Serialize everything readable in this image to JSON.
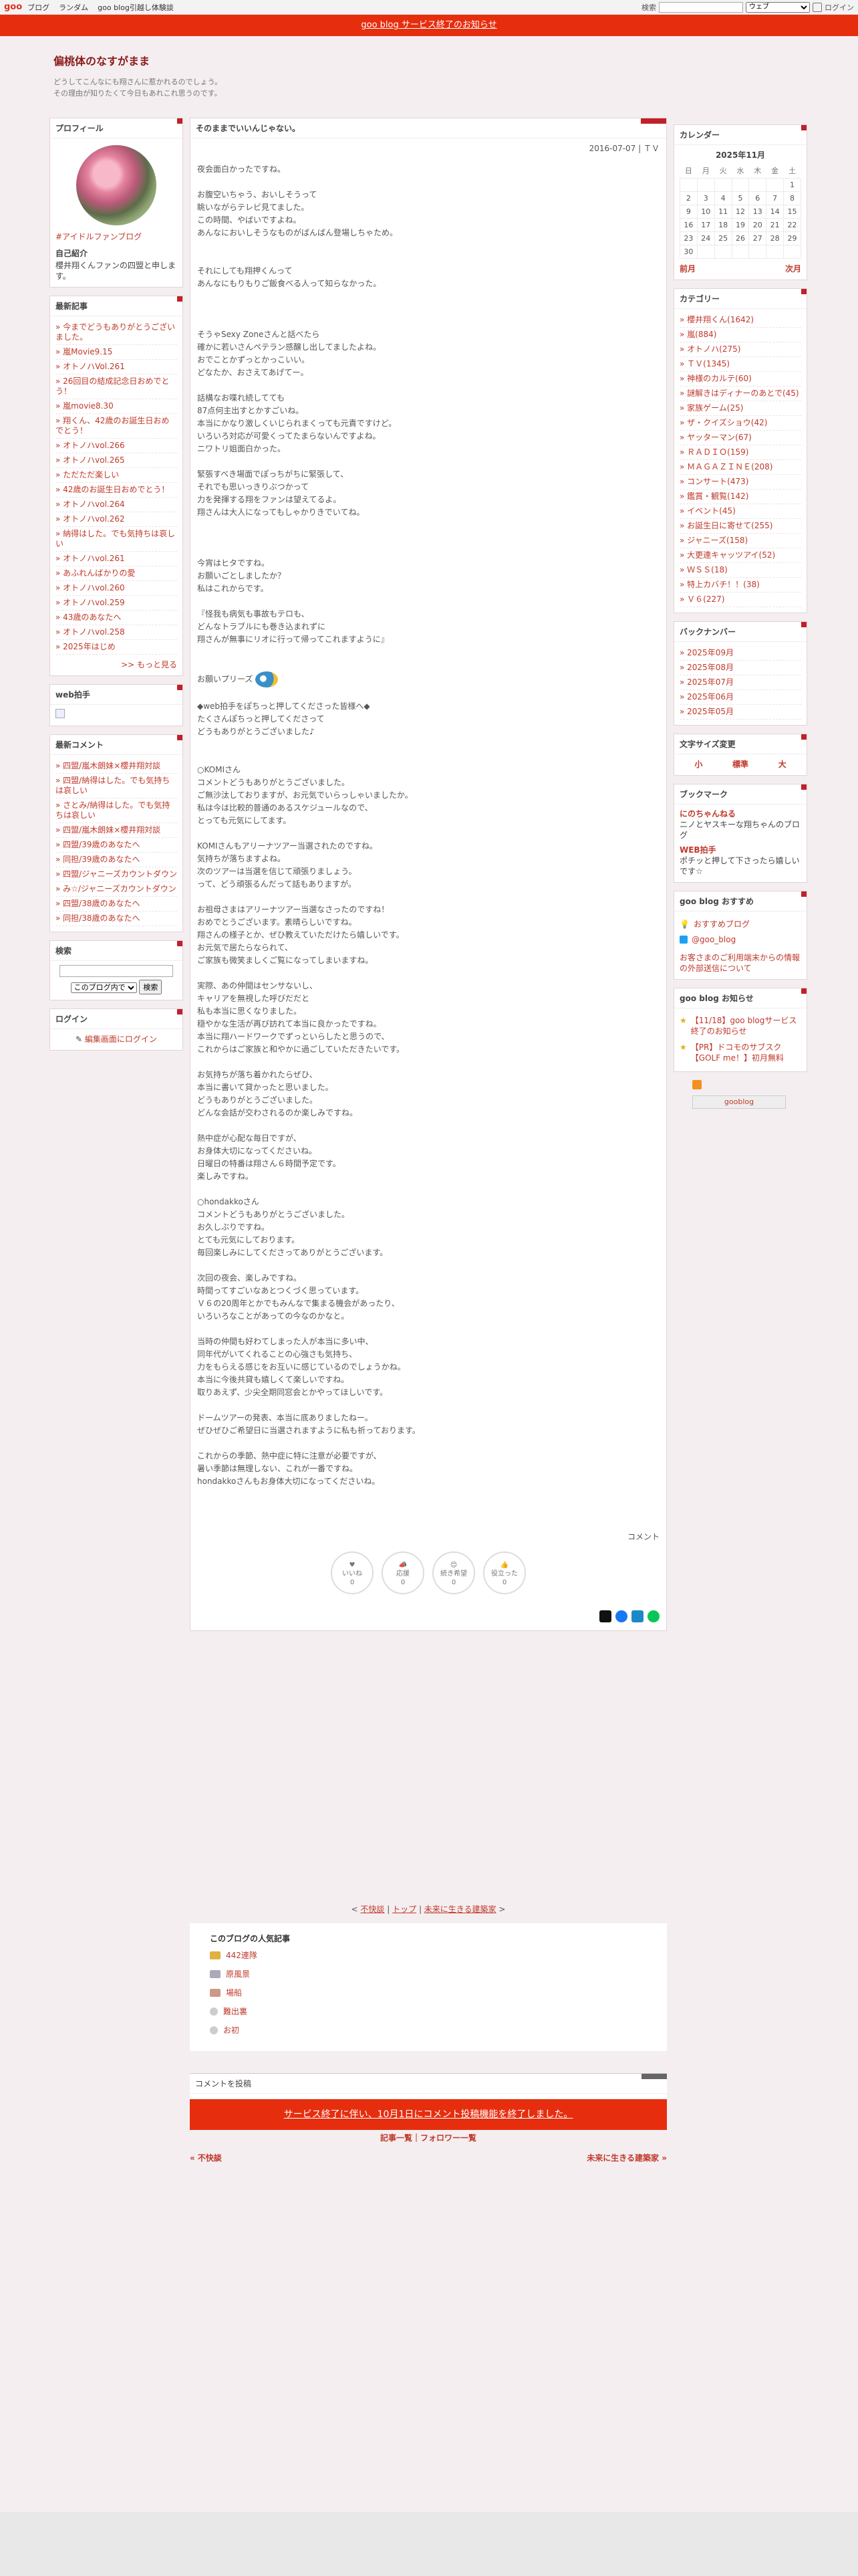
{
  "topbar": {
    "logo": "goo",
    "nav": [
      "ブログ",
      "ランダム",
      "goo blog引越し体験談"
    ],
    "search_label": "検索",
    "search_select": "ウェブ",
    "login": "ログイン"
  },
  "notice": "goo blog サービス終了のお知らせ",
  "header": {
    "title": "偏桃体のなすがまま",
    "desc1": "どうしてこんなにも翔さんに惹かれるのでしょう。",
    "desc2": "その理由が知りたくて今日もあれこれ思うのです。"
  },
  "profile": {
    "heading": "プロフィール",
    "fan": "#アイドルファンブログ",
    "intro_label": "自己紹介",
    "intro": "櫻井翔くんファンの四盟と申します。"
  },
  "recent": {
    "heading": "最新記事",
    "items": [
      "今までどうもありがとうございました。",
      "嵐Movie9.15",
      "オトノハVol.261",
      "26回目の結成記念日おめでとう！",
      "嵐movie8.30",
      "翔くん、42歳のお誕生日おめでとう！",
      "オトノハvol.266",
      "オトノハvol.265",
      "ただただ楽しい",
      "42歳のお誕生日おめでとう！",
      "オトノハvol.264",
      "オトノハvol.262",
      "納得はした。でも気持ちは哀しい",
      "オトノハvol.261",
      "あふれんばかりの愛",
      "オトノハvol.260",
      "オトノハvol.259",
      "43歳のあなたへ",
      "オトノハvol.258",
      "2025年はじめ"
    ],
    "more": ">> もっと見る"
  },
  "webclap": {
    "heading": "web拍手"
  },
  "comments": {
    "heading": "最新コメント",
    "items": [
      "四盟/嵐木朗妹×櫻井翔対談",
      "四盟/納得はした。でも気持ちは哀しい",
      "さとみ/納得はした。でも気持ちは哀しい",
      "四盟/嵐木朗妹×櫻井翔対談",
      "四盟/39歳のあなたへ",
      "同担/39歳のあなたへ",
      "四盟/ジャニーズカウントダウン",
      "み☆/ジャニーズカウントダウン",
      "四盟/38歳のあなたへ",
      "同担/38歳のあなたへ"
    ]
  },
  "search": {
    "heading": "検索",
    "select": "このブログ内で",
    "button": "検索"
  },
  "login": {
    "heading": "ログイン",
    "link": "編集画面にログイン"
  },
  "article": {
    "title": "そのままでいいんじゃない。",
    "date": "2016-07-07 | ＴＶ",
    "p1": "夜会面白かったですね。\n\nお腹空いちゃう、おいしそうって\n眺いながらテレビ見てました。\nこの時間、やばいですよね。\nあんなにおいしそうなものがばんばん登場しちゃため。\n\n\nそれにしても翔押くんって\nあんなにもりもりご飯食べる人って知らなかった。\n\n\n\nそうゃSexy Zoneさんと話べたら\n確かに若いさんペテラン感醸し出してましたよね。\nおでことかずっとかっこいい。\nどなたか、おさえてあげてー。\n\n話構なお喋れ続してても\n87点何主出すとかすごいね。\n本当にかなり激しくいじられまくっても元責ですけど。\nいろいろ対応が可愛くってたまらないんですよね。\nニワトリ姐面白かった。\n\n緊張すべき場面でぽっちがちに緊張して、\nそれでも思いっきりぶつかって\n力を発揮する翔をファンは望えてるよ。\n翔さんは大人になってもしゃかりきでいてね。\n\n\n\n今宵はヒタですね。\nお願いごとしましたか？\n私はこれからです。\n\n『怪我も病気も事故もテロも、\nどんなトラブルにも巻き込まれずに\n翔さんが無事にリオに行って帰ってこれますように』\n\n\nお願いプリーズ",
    "p2": "\n\n◆web拍手をぽちっと押してくださった皆様へ◆\nたくさんぽちっと押してくださって\nどうもありがとうございました♪\n\n\n○KOMIさん\nコメントどうもありがとうございました。\nご無沙汰しておりますが、お元気でいらっしゃいましたか。\n私は今は比較的普通のあるスケジュールなので、\nとっても元気にしてます。\n\nKOMIさんもアリーナツアー当選されたのですね。\n気持ちが落ちますよね。\n次のツアーは当選を信じて頑張りましょう。\nって、どう頑張るんだって話もありますが。\n\nお祖母さまはアリーナツアー当選なさったのですね！\nおめでとうございます。素晴らしいですね。\n翔さんの様子とか、ぜひ教えていただけたら嬉しいです。\nお元気で居たらなられて、\nご家族も微笑ましくご覧になってしまいますね。\n\n実際、あの仲間はセンサないし、\nキャリアを無視した呼びだだと\n私も本当に思くなりました。\n穏やかな生活が再び訪れて本当に良かったですね。\n本当に翔ハードワークでずっといらしたと思うので、\nこれからはご家族と和やかに過ごしていただきたいです。\n\nお気持ちが落ち着かれたらぜひ、\n本当に書いて貸かったと思いました。\nどうもありがとうございました。\nどんな会話が交わされるのか楽しみですね。\n\n熱中症が心配な毎日ですが、\nお身体大切になってくださいね。\n日曜日の特番は翔さん６時間予定です。\n楽しみですね。\n\n○hondakkoさん\nコメントどうもありがとうございました。\nお久しぶりですね。\nとても元気にしております。\n毎回楽しみにしてくださってありがとうございます。\n\n次回の夜会、楽しみですね。\n時間ってすごいなあとつくづく思っています。\nＶ６の20周年とかでもみんなで集まる機会があったり、\nいろいろなことがあっての今なのかなと。\n\n当時の仲間も好わてしまった人が本当に多い中、\n同年代がいてくれることの心強さも気持ち、\n力をもらえる感じをお互いに感じているのでしょうかね。\n本当に今後共貸も嬉しくて楽しいですね。\n取りあえず、少尖全期同窓会とかやってほしいです。\n\nドームツアーの発表、本当に底ありましたねー。\nぜひぜひご希望日に当選されますように私も祈っております。\n\nこれからの季節、熱中症に特に注意が必要ですが、\n暑い季節は無理しない、これが一番ですね。\nhondakkoさんもお身体大切になってくださいね。"
  },
  "comment_label": "コメント",
  "reactions": [
    {
      "label": "いいね",
      "count": "0"
    },
    {
      "label": "応援",
      "count": "0"
    },
    {
      "label": "続き希望",
      "count": "0"
    },
    {
      "label": "役立った",
      "count": "0"
    }
  ],
  "pager": {
    "prev": "不快談",
    "top": "トップ",
    "next": "未来に生きる建築家"
  },
  "popular": {
    "heading": "このブログの人気記事",
    "items": [
      "442連隊",
      "原風景",
      "場船",
      "難出裏",
      "お初"
    ]
  },
  "post_comment": {
    "heading": "コメントを投稿",
    "closed": "サービス終了に伴い、10月1日にコメント投稿機能を終了しました。"
  },
  "links": "記事一覧｜フォロワー一覧",
  "nav": {
    "prev": "« 不快談",
    "next": "未来に生きる建築家 »"
  },
  "calendar": {
    "heading": "カレンダー",
    "month": "2025年11月",
    "dow": [
      "日",
      "月",
      "火",
      "水",
      "木",
      "金",
      "土"
    ],
    "weeks": [
      [
        "",
        "",
        "",
        "",
        "",
        "",
        "1"
      ],
      [
        "2",
        "3",
        "4",
        "5",
        "6",
        "7",
        "8"
      ],
      [
        "9",
        "10",
        "11",
        "12",
        "13",
        "14",
        "15"
      ],
      [
        "16",
        "17",
        "18",
        "19",
        "20",
        "21",
        "22"
      ],
      [
        "23",
        "24",
        "25",
        "26",
        "27",
        "28",
        "29"
      ],
      [
        "30",
        "",
        "",
        "",
        "",
        "",
        ""
      ]
    ],
    "prev": "前月",
    "next": "次月"
  },
  "categories": {
    "heading": "カテゴリー",
    "items": [
      "櫻井翔くん(1642)",
      "嵐(884)",
      "オトノハ(275)",
      "ＴＶ(1345)",
      "神様のカルテ(60)",
      "謎解きはディナーのあとで(45)",
      "家族ゲーム(25)",
      "ザ・クイズショウ(42)",
      "ヤッターマン(67)",
      "ＲＡＤＩＯ(159)",
      "ＭＡＧＡＺＩＮＥ(208)",
      "コンサート(473)",
      "鑑賞・観覧(142)",
      "イベント(45)",
      "お誕生日に寄せて(255)",
      "ジャニーズ(158)",
      "大更連キャッツアイ(52)",
      "ＷＳＳ(18)",
      "特上カバチ！！(38)",
      "Ｖ６(227)"
    ]
  },
  "backnumber": {
    "heading": "バックナンバー",
    "items": [
      "2025年09月",
      "2025年08月",
      "2025年07月",
      "2025年06月",
      "2025年05月"
    ]
  },
  "fontsize": {
    "heading": "文字サイズ変更",
    "small": "小",
    "mid": "標準",
    "big": "大"
  },
  "bookmark": {
    "heading": "ブックマーク",
    "b1": "にのちゃんねる",
    "b1d": "ニノとヤスキーな翔ちゃんのブログ",
    "b2": "WEB拍手",
    "b2d": "ポチッと押して下さったら嬉しいです☆"
  },
  "goo_rec": {
    "heading": "goo blog おすすめ",
    "item1": "おすすめブログ",
    "item2": "@goo_blog",
    "warn": "お客さまのご利用端末からの情報の外部送信について"
  },
  "goo_news": {
    "heading": "goo blog お知らせ",
    "item1": "【11/18】goo blogサービス終了のお知らせ",
    "item2": "【PR】ドコモのサブスク【GOLF me！】初月無料"
  },
  "goo_badge": "gooblog"
}
